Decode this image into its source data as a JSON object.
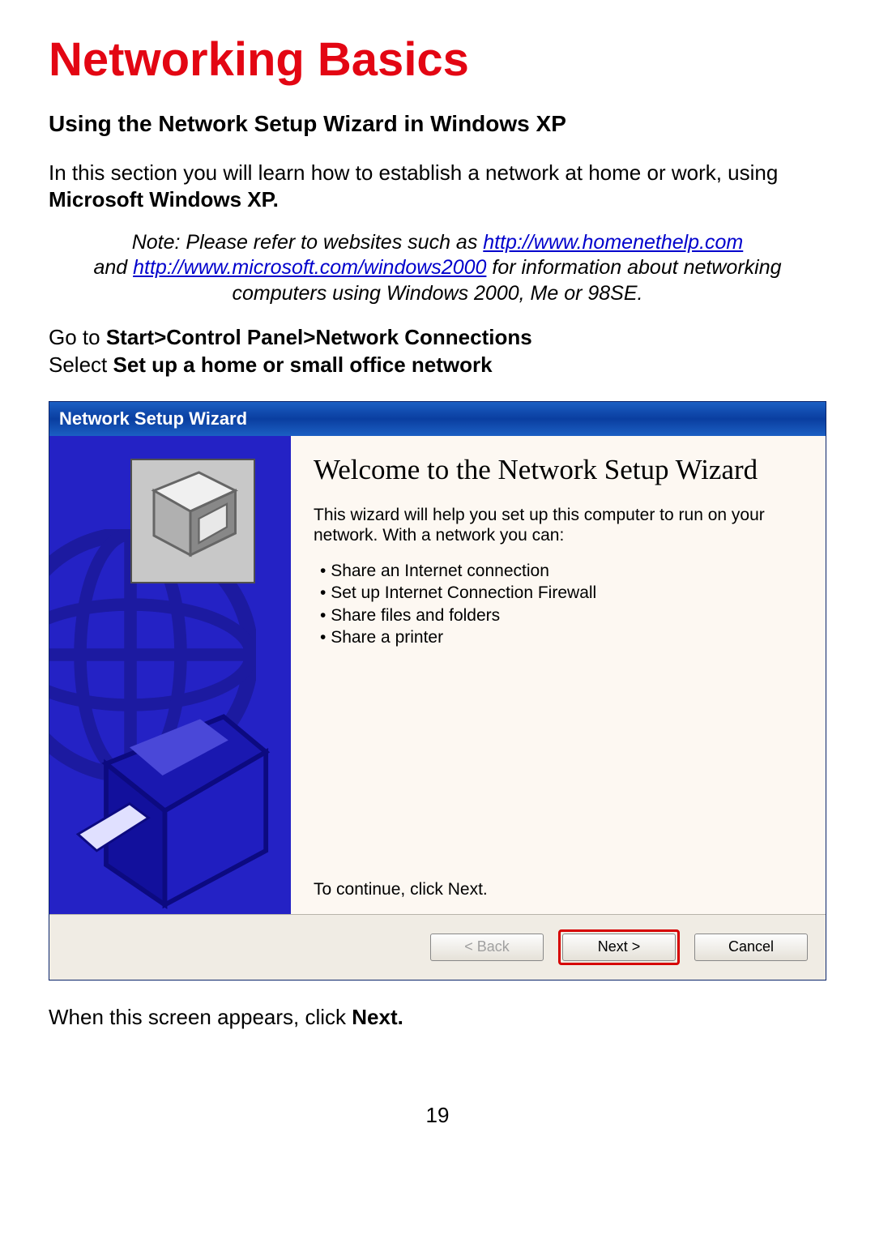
{
  "doc": {
    "title": "Networking Basics",
    "subtitle": "Using the Network Setup Wizard in Windows XP",
    "intro_pre": "In this section you will learn how to establish a network at home or work, using ",
    "intro_bold": "Microsoft Windows XP.",
    "note_pre": "Note:  Please refer to websites such as ",
    "note_link1": "http://www.homenethelp.com",
    "note_mid": " and ",
    "note_link2": "http://www.microsoft.com/windows2000",
    "note_post": "  for information about networking computers using Windows 2000, Me or 98SE.",
    "instr_pre": "Go to ",
    "instr_bold1": "Start>Control Panel>Network Connections",
    "instr_mid": "Select ",
    "instr_bold2": "Set up a home or small office network",
    "after_pre": "When this screen appears, click ",
    "after_bold": "Next.",
    "page_number": "19"
  },
  "dialog": {
    "title": "Network Setup Wizard",
    "heading": "Welcome to the Network Setup Wizard",
    "desc": "This wizard will help you set up this computer to run on your network. With a network you can:",
    "bullets": [
      "Share an Internet connection",
      "Set up Internet Connection Firewall",
      "Share files and folders",
      "Share a printer"
    ],
    "continue": "To continue, click Next.",
    "back": "< Back",
    "next": "Next >",
    "cancel": "Cancel"
  }
}
